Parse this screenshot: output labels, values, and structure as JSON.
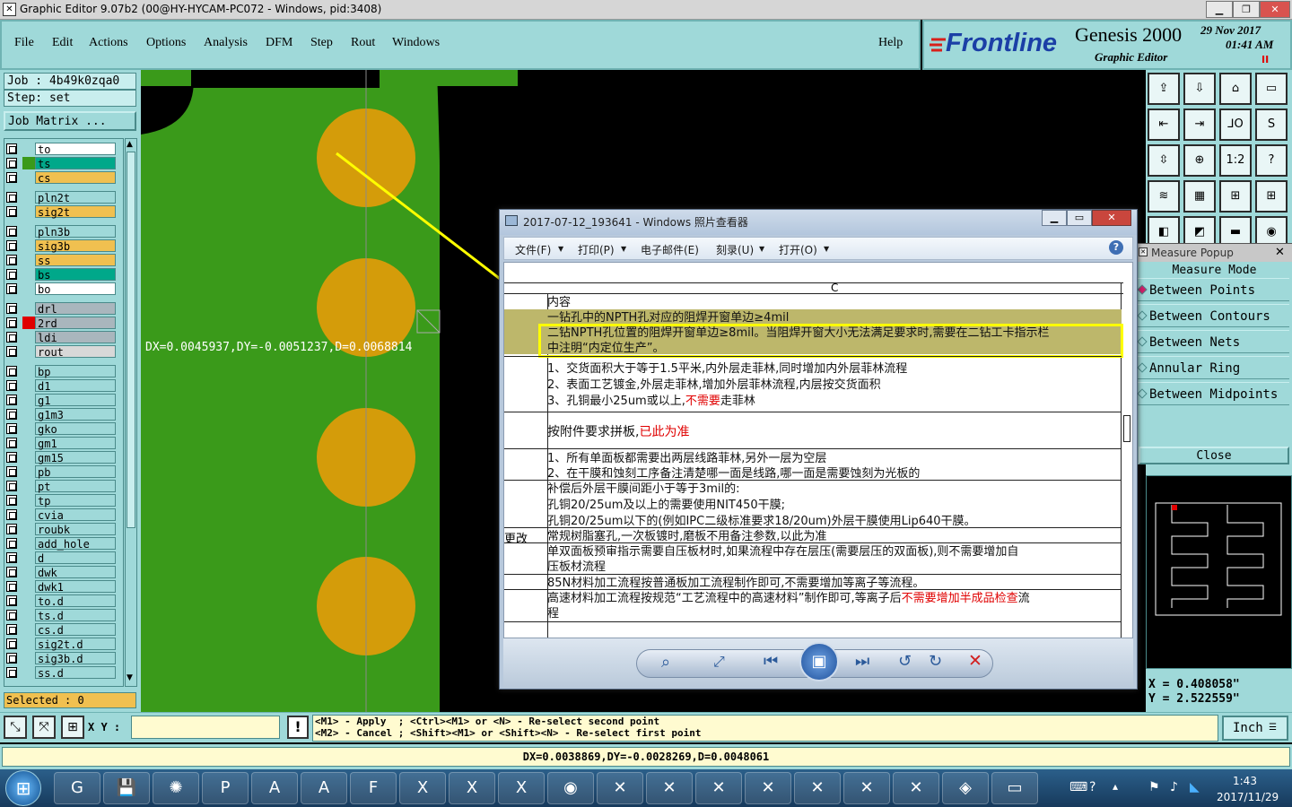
{
  "window": {
    "title": "Graphic Editor 9.07b2 (00@HY-HYCAM-PC072 - Windows, pid:3408)",
    "minimize": "▁",
    "maximize": "❐",
    "close": "✕"
  },
  "menu": [
    "File",
    "Edit",
    "Actions",
    "Options",
    "Analysis",
    "DFM",
    "Step",
    "Rout",
    "Windows"
  ],
  "help": "Help",
  "brand": {
    "logo": "Frontline",
    "product": "Genesis 2000",
    "subtitle": "Graphic Editor",
    "date": "29 Nov 2017",
    "time": "01:41 AM",
    "indicator": "II"
  },
  "job": {
    "job_label": "Job : 4b49k0zqa0",
    "step_label": "Step: set",
    "matrix_button": "Job Matrix ..."
  },
  "layers": [
    {
      "name": "to",
      "color": "#ffffff",
      "swatch": "#9fd9d9"
    },
    {
      "name": "ts",
      "color": "#00a88a",
      "swatch": "#3a9a1a"
    },
    {
      "name": "cs",
      "color": "#f0c050",
      "swatch": "#9fd9d9"
    },
    {
      "name": "pln2t",
      "color": "#9fd9d9",
      "swatch": "#9fd9d9"
    },
    {
      "name": "sig2t",
      "color": "#f0c050",
      "swatch": "#9fd9d9"
    },
    {
      "name": "pln3b",
      "color": "#9fd9d9",
      "swatch": "#9fd9d9"
    },
    {
      "name": "sig3b",
      "color": "#f0c050",
      "swatch": "#9fd9d9"
    },
    {
      "name": "ss",
      "color": "#f0c050",
      "swatch": "#9fd9d9"
    },
    {
      "name": "bs",
      "color": "#00a88a",
      "swatch": "#9fd9d9"
    },
    {
      "name": "bo",
      "color": "#ffffff",
      "swatch": "#9fd9d9"
    },
    {
      "name": "drl",
      "color": "#a9b6bd",
      "swatch": "#9fd9d9"
    },
    {
      "name": "2rd",
      "color": "#a9b6bd",
      "swatch": "#e00000"
    },
    {
      "name": "ldi",
      "color": "#a9b6bd",
      "swatch": "#9fd9d9"
    },
    {
      "name": "rout",
      "color": "#d8d8d8",
      "swatch": "#9fd9d9"
    },
    {
      "name": "bp",
      "color": "#9fd9d9",
      "swatch": "#9fd9d9"
    },
    {
      "name": "d1",
      "color": "#9fd9d9",
      "swatch": "#9fd9d9"
    },
    {
      "name": "g1",
      "color": "#9fd9d9",
      "swatch": "#9fd9d9"
    },
    {
      "name": "g1m3",
      "color": "#9fd9d9",
      "swatch": "#9fd9d9"
    },
    {
      "name": "gko",
      "color": "#9fd9d9",
      "swatch": "#9fd9d9"
    },
    {
      "name": "gm1",
      "color": "#9fd9d9",
      "swatch": "#9fd9d9"
    },
    {
      "name": "gm15",
      "color": "#9fd9d9",
      "swatch": "#9fd9d9"
    },
    {
      "name": "pb",
      "color": "#9fd9d9",
      "swatch": "#9fd9d9"
    },
    {
      "name": "pt",
      "color": "#9fd9d9",
      "swatch": "#9fd9d9"
    },
    {
      "name": "tp",
      "color": "#9fd9d9",
      "swatch": "#9fd9d9"
    },
    {
      "name": "cvia",
      "color": "#9fd9d9",
      "swatch": "#9fd9d9"
    },
    {
      "name": "roubk",
      "color": "#9fd9d9",
      "swatch": "#9fd9d9"
    },
    {
      "name": "add_hole",
      "color": "#9fd9d9",
      "swatch": "#9fd9d9"
    },
    {
      "name": "d",
      "color": "#9fd9d9",
      "swatch": "#9fd9d9"
    },
    {
      "name": "dwk",
      "color": "#9fd9d9",
      "swatch": "#9fd9d9"
    },
    {
      "name": "dwk1",
      "color": "#9fd9d9",
      "swatch": "#9fd9d9"
    },
    {
      "name": "to.d",
      "color": "#9fd9d9",
      "swatch": "#9fd9d9"
    },
    {
      "name": "ts.d",
      "color": "#9fd9d9",
      "swatch": "#9fd9d9"
    },
    {
      "name": "cs.d",
      "color": "#9fd9d9",
      "swatch": "#9fd9d9"
    },
    {
      "name": "sig2t.d",
      "color": "#9fd9d9",
      "swatch": "#9fd9d9"
    },
    {
      "name": "sig3b.d",
      "color": "#9fd9d9",
      "swatch": "#9fd9d9"
    },
    {
      "name": "ss.d",
      "color": "#9fd9d9",
      "swatch": "#9fd9d9"
    }
  ],
  "selected": "Selected : 0",
  "canvas": {
    "measure_text": "DX=0.0045937,DY=-0.0051237,D=0.0068814"
  },
  "tools": [
    "⇪",
    "⇩",
    "⌂",
    "▭",
    "⇤",
    "⇥",
    "⅃O",
    "S",
    "⇳",
    "⊕",
    "1:2",
    "?",
    "≋",
    "▦",
    "⊞",
    "⊞",
    "◧",
    "◩",
    "▬",
    "◉"
  ],
  "measure_popup": {
    "title": "Measure Popup",
    "mode_label": "Measure Mode",
    "options": [
      "Between Points",
      "Between Contours",
      "Between Nets",
      "Annular Ring",
      "Between Midpoints"
    ],
    "close": "Close"
  },
  "coords": {
    "x": "X = 0.408058\"",
    "y": "Y = 2.522559\""
  },
  "units": "Inch",
  "bottom": {
    "xy_label": "X Y :",
    "xy_value": "",
    "alert": "!",
    "hint1": "<M1> - Apply  ; <Ctrl><M1> or <N> - Re-select second point",
    "hint2": "<M2> - Cancel ; <Shift><M1> or <Shift><N> - Re-select first point"
  },
  "status": "DX=0.0038869,DY=-0.0028269,D=0.0048061",
  "viewer": {
    "title": "2017-07-12_193641 - Windows 照片查看器",
    "menu": [
      "文件(F)",
      "打印(P)",
      "电子邮件(E)",
      "刻录(U)",
      "打开(O)"
    ],
    "col_header": "C",
    "side_label": "更改",
    "rows": [
      "内容",
      "一钻孔中的NPTH孔对应的阻焊开窗单边≥4mil",
      "二钻NPTH孔位置的阻焊开窗单边≥8mil。当阻焊开窗大小无法满足要求时,需要在二钻工卡指示栏",
      "中注明“内定位生产”。",
      "1、交货面积大于等于1.5平米,内外层走菲林,同时增加内外层菲林流程",
      "2、表面工艺镀金,外层走菲林,增加外层菲林流程,内层按交货面积",
      "3、孔铜最小25um或以上,",
      "不需要",
      "走菲林",
      "按附件要求拼板,",
      "已此为准",
      "1、所有单面板都需要出两层线路菲林,另外一层为空层",
      "2、在干膜和蚀刻工序备注清楚哪一面是线路,哪一面是需要蚀刻为光板的",
      "补偿后外层干膜间距小于等于3mil的:",
      "孔铜20/25um及以上的需要使用NIT450干膜;",
      "孔铜20/25um以下的(例如IPC二级标准要求18/20um)外层干膜使用Lip640干膜。",
      "常规树脂塞孔,一次板镀时,磨板不用备注参数,以此为准",
      "单双面板预审指示需要自压板材时,如果流程中存在层压(需要层压的双面板),则不需要增加自",
      "压板材流程",
      "85N材料加工流程按普通板加工流程制作即可,不需要增加等离子等流程。",
      "高速材料加工流程按规范“工艺流程中的高速材料”制作即可,等离子后",
      "不需要增加半成品检查",
      "流",
      "程"
    ]
  },
  "taskbar": {
    "clock_time": "1:43",
    "clock_date": "2017/11/29"
  }
}
